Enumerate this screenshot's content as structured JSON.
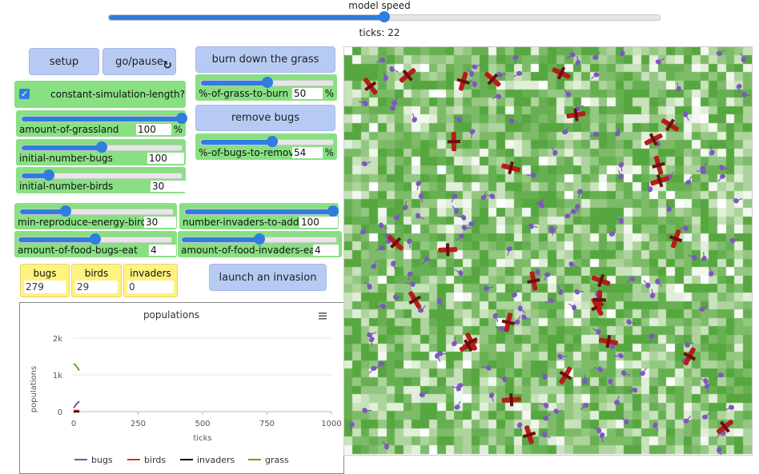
{
  "speed": {
    "label": "model speed",
    "ticks_text": "ticks: 22",
    "value": 0.5
  },
  "buttons": {
    "setup": "setup",
    "go": "go/pause",
    "burn": "burn down the grass",
    "remove": "remove bugs",
    "invasion": "launch an invasion"
  },
  "switch": {
    "label": "constant-simulation-length?",
    "checked": true
  },
  "sliders": [
    {
      "id": "grassland",
      "label": "amount-of-grassland",
      "value": "100",
      "unit": "%",
      "fraction": 1.0
    },
    {
      "id": "bugs",
      "label": "initial-number-bugs",
      "value": "100",
      "unit": "",
      "fraction": 0.5
    },
    {
      "id": "birds",
      "label": "initial-number-birds",
      "value": "30",
      "unit": "",
      "fraction": 0.17
    },
    {
      "id": "burn",
      "label": "%-of-grass-to-burn",
      "value": "50",
      "unit": "%",
      "fraction": 0.5
    },
    {
      "id": "remove",
      "label": "%-of-bugs-to-remove",
      "value": "54",
      "unit": "%",
      "fraction": 0.54
    },
    {
      "id": "repro",
      "label": "min-reproduce-energy-birds",
      "value": "30",
      "unit": "",
      "fraction": 0.3
    },
    {
      "id": "invaders",
      "label": "number-invaders-to-add",
      "value": "100",
      "unit": "",
      "fraction": 1.0
    },
    {
      "id": "foodbugs",
      "label": "amount-of-food-bugs-eat",
      "value": "4",
      "unit": "",
      "fraction": 0.5
    },
    {
      "id": "foodinv",
      "label": "amount-of-food-invaders-eat",
      "value": "4",
      "unit": "",
      "fraction": 0.5
    }
  ],
  "monitors": [
    {
      "label": "bugs",
      "value": "279"
    },
    {
      "label": "birds",
      "value": "29"
    },
    {
      "label": "invaders",
      "value": "0"
    }
  ],
  "plot": {
    "title": "populations",
    "menu_icon": "hamburger-menu-icon",
    "chart_data": {
      "type": "line",
      "xlabel": "ticks",
      "ylabel": "populations",
      "xlim": [
        0,
        1000
      ],
      "ylim": [
        0,
        2000
      ],
      "x_ticks": [
        "0",
        "250",
        "500",
        "750",
        "1000"
      ],
      "y_ticks": [
        "0",
        "1k",
        "2k"
      ],
      "series": [
        {
          "name": "bugs",
          "color": "#7e4fa8",
          "x": [
            0,
            5,
            10,
            15,
            22
          ],
          "values": [
            100,
            150,
            200,
            240,
            279
          ]
        },
        {
          "name": "birds",
          "color": "#c0392b",
          "x": [
            0,
            5,
            10,
            15,
            22
          ],
          "values": [
            30,
            30,
            29,
            29,
            29
          ]
        },
        {
          "name": "invaders",
          "color": "#000000",
          "x": [
            0,
            22
          ],
          "values": [
            0,
            0
          ]
        },
        {
          "name": "grass",
          "color": "#5aa832",
          "x": [
            0,
            5,
            10,
            15,
            22
          ],
          "values": [
            1300,
            1280,
            1240,
            1190,
            1120
          ]
        }
      ]
    }
  },
  "colors": {
    "button": "#b7caf3",
    "widget": "#88e082",
    "monitor": "#fff27f",
    "slider": "#2f7de1",
    "bug": "#7e57c2",
    "bird": "#b71c1c"
  }
}
